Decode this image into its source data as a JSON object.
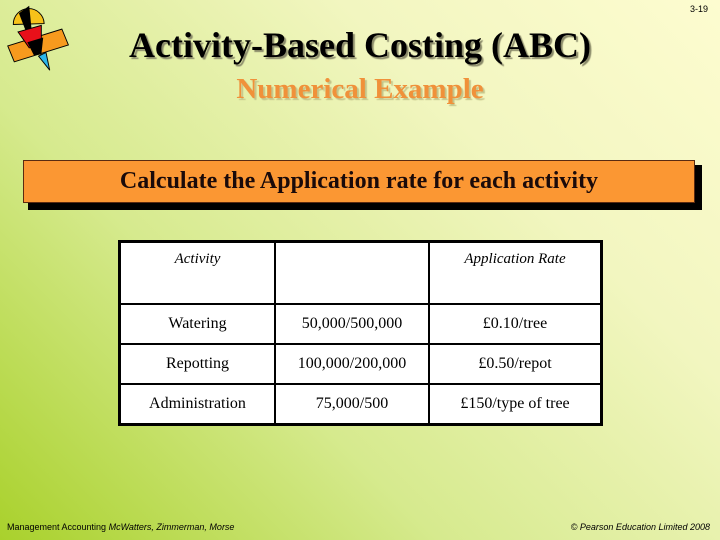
{
  "slide": {
    "number": "3-19",
    "title": "Activity-Based Costing (ABC)",
    "subtitle": "Numerical Example",
    "banner": "Calculate the Application rate for each activity"
  },
  "table": {
    "headers": [
      "Activity",
      "",
      "Application Rate"
    ],
    "rows": [
      {
        "activity": "Watering",
        "calculation": "50,000/500,000",
        "rate": "£0.10/tree"
      },
      {
        "activity": "Repotting",
        "calculation": "100,000/200,000",
        "rate": "£0.50/repot"
      },
      {
        "activity": "Administration",
        "calculation": "75,000/500",
        "rate": "£150/type of tree"
      }
    ]
  },
  "footer": {
    "book": "Management Accounting",
    "authors": "McWatters, Zimmerman, Morse",
    "separator": ", ",
    "copyright": "© Pearson Education Limited 2008"
  },
  "colors": {
    "banner": "#fb9733",
    "subtitle": "#f0913a",
    "logo_yellow": "#f7c21a",
    "logo_red": "#e8101a",
    "logo_orange": "#f79a1e",
    "logo_blue": "#2bb6ea"
  }
}
